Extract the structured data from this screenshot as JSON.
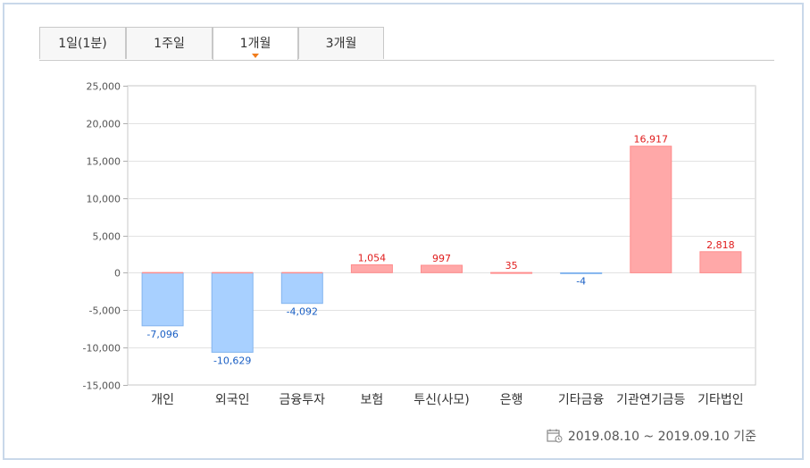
{
  "tabs": [
    {
      "label": "1일(1분)",
      "active": false
    },
    {
      "label": "1주일",
      "active": false
    },
    {
      "label": "1개월",
      "active": true
    },
    {
      "label": "3개월",
      "active": false
    }
  ],
  "footer": {
    "date_range": "2019.08.10 ~ 2019.09.10 기준"
  },
  "colors": {
    "positive_fill": "#ffa8a8",
    "positive_stroke": "#ff8c8c",
    "negative_fill": "#a8d0ff",
    "negative_stroke": "#82b4ee",
    "positive_label": "#e01c1c",
    "negative_label": "#1a5fc4"
  },
  "chart_data": {
    "type": "bar",
    "categories": [
      "개인",
      "외국인",
      "금융투자",
      "보험",
      "투신(사모)",
      "은행",
      "기타금융",
      "기관연기금등",
      "기타법인"
    ],
    "values": [
      -7096,
      -10629,
      -4092,
      1054,
      997,
      35,
      -4,
      16917,
      2818
    ],
    "value_labels": [
      "-7,096",
      "-10,629",
      "-4,092",
      "1,054",
      "997",
      "35",
      "-4",
      "16,917",
      "2,818"
    ],
    "ylim": [
      -15000,
      25000
    ],
    "yticks": [
      25000,
      20000,
      15000,
      10000,
      5000,
      0,
      -5000,
      -10000,
      -15000
    ],
    "ytick_labels": [
      "25,000",
      "20,000",
      "15,000",
      "10,000",
      "5,000",
      "0",
      "-5,000",
      "-10,000",
      "-15,000"
    ],
    "grid": true
  }
}
